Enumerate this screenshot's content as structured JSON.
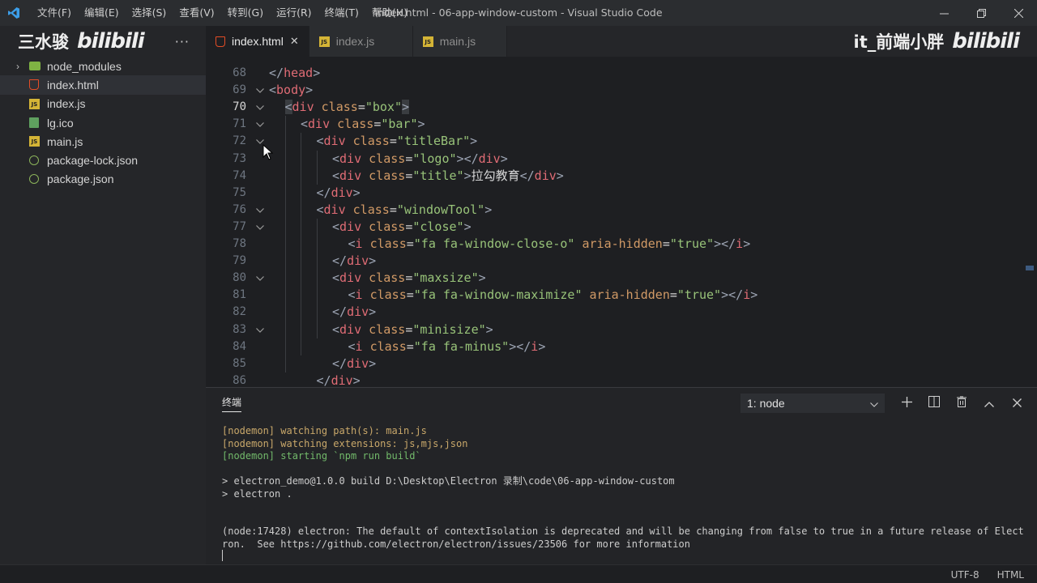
{
  "titlebar": {
    "menus": [
      "文件(F)",
      "编辑(E)",
      "选择(S)",
      "查看(V)",
      "转到(G)",
      "运行(R)",
      "终端(T)",
      "帮助(H)"
    ],
    "title": "index.html - 06-app-window-custom - Visual Studio Code"
  },
  "watermarks": {
    "left_text": "三水骏",
    "left_logo": "bilibili",
    "right_text": "it_前端小胖",
    "right_logo": "bilibili"
  },
  "sidebar": {
    "more": "···",
    "items": [
      {
        "label": "node_modules",
        "icon": "folder-icon",
        "chevron": "›"
      },
      {
        "label": "index.html",
        "icon": "html-file-icon"
      },
      {
        "label": "index.js",
        "icon": "js-file-icon"
      },
      {
        "label": "lg.ico",
        "icon": "image-file-icon"
      },
      {
        "label": "main.js",
        "icon": "js-file-icon"
      },
      {
        "label": "package-lock.json",
        "icon": "json-file-icon"
      },
      {
        "label": "package.json",
        "icon": "json-file-icon"
      }
    ]
  },
  "tabs": [
    {
      "label": "index.html",
      "close": "✕"
    },
    {
      "label": "index.js"
    },
    {
      "label": "main.js"
    }
  ],
  "editor": {
    "partial_top": "</head>",
    "lines": [
      {
        "n": "68",
        "text": ""
      },
      {
        "n": "69",
        "text": "<body>"
      },
      {
        "n": "70",
        "text": "<div class=\"box\">"
      },
      {
        "n": "71",
        "text": "<div class=\"bar\">"
      },
      {
        "n": "72",
        "text": "<div class=\"titleBar\">"
      },
      {
        "n": "73",
        "text": "<div class=\"logo\"></div>"
      },
      {
        "n": "74",
        "text": "<div class=\"title\">拉勾教育</div>"
      },
      {
        "n": "75",
        "text": "</div>"
      },
      {
        "n": "76",
        "text": "<div class=\"windowTool\">"
      },
      {
        "n": "77",
        "text": "<div class=\"close\">"
      },
      {
        "n": "78",
        "text": "<i class=\"fa fa-window-close-o\" aria-hidden=\"true\"></i>"
      },
      {
        "n": "79",
        "text": "</div>"
      },
      {
        "n": "80",
        "text": "<div class=\"maxsize\">"
      },
      {
        "n": "81",
        "text": "<i class=\"fa fa-window-maximize\" aria-hidden=\"true\"></i>"
      },
      {
        "n": "82",
        "text": "</div>"
      },
      {
        "n": "83",
        "text": "<div class=\"minisize\">"
      },
      {
        "n": "84",
        "text": "<i class=\"fa fa-minus\"></i>"
      },
      {
        "n": "85",
        "text": "</div>"
      },
      {
        "n": "86",
        "text": "</div>"
      }
    ]
  },
  "panel": {
    "title": "终端",
    "terminal_select": "1: node",
    "output": [
      "[nodemon] watching path(s): main.js",
      "[nodemon] watching extensions: js,mjs,json",
      "[nodemon] starting `npm run build`",
      "",
      "> electron_demo@1.0.0 build D:\\Desktop\\Electron 录制\\code\\06-app-window-custom",
      "> electron .",
      "",
      "",
      "(node:17428) electron: The default of contextIsolation is deprecated and will be changing from false to true in a future release of Elect",
      "ron.  See https://github.com/electron/electron/issues/23506 for more information"
    ]
  },
  "statusbar": {
    "encoding": "UTF-8",
    "language": "HTML"
  }
}
